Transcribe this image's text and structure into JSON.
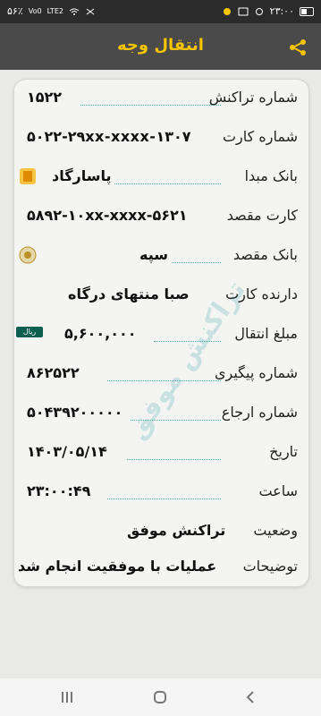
{
  "status_bar": {
    "time": "۲۳:۰۰",
    "left_text": "۵۶٪",
    "network_labels": [
      "Vo0",
      "LTE2"
    ]
  },
  "header": {
    "title": "انتقال وجه",
    "share_icon": "share-icon"
  },
  "transaction": {
    "rows": [
      {
        "label": "شماره تراکنش",
        "value": "۱۵۲۲"
      },
      {
        "label": "شماره کارت",
        "value": "۵۰۲۲-۲۹xx-xxxx-۱۳۰۷"
      },
      {
        "label": "بانک مبدا",
        "value": "پاسارگاد"
      },
      {
        "label": "کارت مقصد",
        "value": "۵۸۹۲-۱۰xx-xxxx-۵۶۲۱"
      },
      {
        "label": "بانک مقصد",
        "value": "سپه"
      },
      {
        "label": "دارنده کارت",
        "value": "صبا منتهای درگاه"
      },
      {
        "label": "مبلغ انتقال",
        "value": "۵,۶۰۰,۰۰۰",
        "badge": "ریال"
      },
      {
        "label": "شماره پیگیری",
        "value": "۸۶۲۵۲۲"
      },
      {
        "label": "شماره ارجاع",
        "value": "۵۰۴۳۹۲۰۰۰۰۰"
      },
      {
        "label": "تاریخ",
        "value": "۱۴۰۳/۰۵/۱۴"
      },
      {
        "label": "ساعت",
        "value": "۲۳:۰۰:۴۹"
      },
      {
        "label": "وضعیت",
        "value": "تراکنش موفق"
      },
      {
        "label": "توضیحات",
        "value": "عملیات با موفقیت انجام شد"
      }
    ],
    "watermark_text": "تراکنش موفق"
  },
  "nav_bar": {
    "recent_icon": "recent-apps-icon",
    "home_icon": "home-icon",
    "back_icon": "back-icon"
  }
}
